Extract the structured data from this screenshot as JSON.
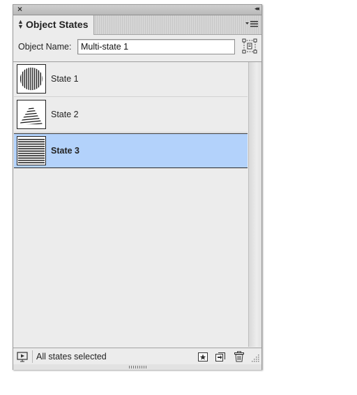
{
  "panel": {
    "close_glyph": "×",
    "collapse_glyph": "◂◂",
    "tab_title": "Object States",
    "menu_icon": "panel-menu-icon"
  },
  "object_name": {
    "label": "Object Name:",
    "value": "Multi-state 1",
    "convert_icon": "convert-selection-icon"
  },
  "states": [
    {
      "label": "State 1",
      "thumbnail": "vertical-stripes-circle",
      "selected": false
    },
    {
      "label": "State 2",
      "thumbnail": "striped-triangle",
      "selected": false
    },
    {
      "label": "State 3",
      "thumbnail": "horizontal-stripes-square",
      "selected": true
    }
  ],
  "footer": {
    "status": "All states selected",
    "icons": [
      "preview-icon",
      "new-state-icon",
      "copy-to-state-icon",
      "trash-icon"
    ]
  },
  "colors": {
    "selection": "#b3d2fb",
    "panel_bg": "#ececec"
  }
}
